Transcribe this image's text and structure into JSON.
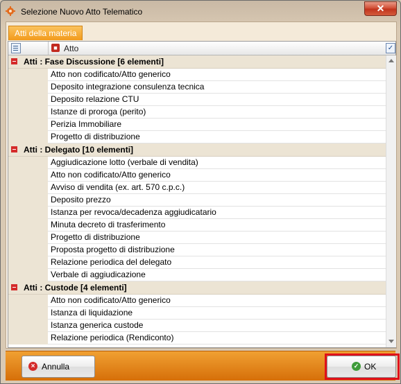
{
  "window": {
    "title": "Selezione Nuovo Atto Telematico",
    "close_glyph": "✕"
  },
  "tabs": [
    {
      "label": "Atti della materia",
      "active": true
    }
  ],
  "grid": {
    "column_label": "Atto",
    "groups": [
      {
        "label": "Atti : Fase Discussione  [6 elementi]",
        "rows": [
          "Atto non codificato/Atto generico",
          "Deposito integrazione consulenza tecnica",
          "Deposito relazione CTU",
          "Istanze di proroga (perito)",
          "Perizia Immobiliare",
          "Progetto di distribuzione"
        ]
      },
      {
        "label": "Atti : Delegato  [10 elementi]",
        "rows": [
          "Aggiudicazione lotto (verbale di vendita)",
          "Atto non codificato/Atto generico",
          "Avviso di vendita (ex. art. 570 c.p.c.)",
          "Deposito prezzo",
          "Istanza per revoca/decadenza aggiudicatario",
          "Minuta decreto di trasferimento",
          "Progetto di distribuzione",
          "Proposta progetto di distribuzione",
          "Relazione periodica del delegato",
          "Verbale di aggiudicazione"
        ]
      },
      {
        "label": "Atti : Custode  [4 elementi]",
        "rows": [
          "Atto non codificato/Atto generico",
          "Istanza di liquidazione",
          "Istanza generica custode",
          "Relazione periodica (Rendiconto)"
        ]
      }
    ]
  },
  "footer": {
    "cancel_label": "Annulla",
    "ok_label": "OK"
  },
  "colors": {
    "accent": "#f29a1b",
    "highlight_frame": "#e0101a"
  },
  "icons": {
    "app": "gear-icon",
    "group_toggle": "minus-icon",
    "column": "document-icon",
    "column_chooser": "column-chooser-icon"
  }
}
